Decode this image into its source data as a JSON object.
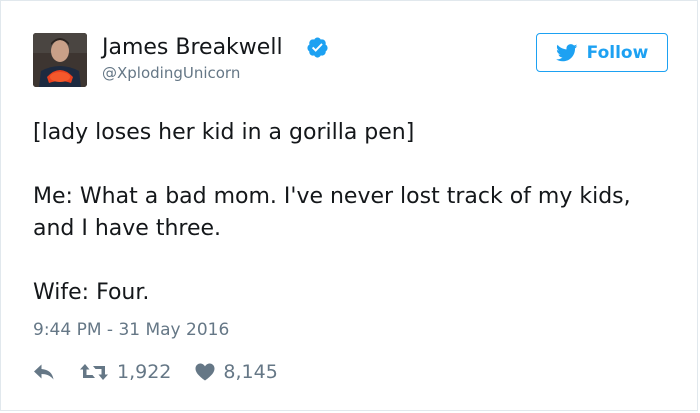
{
  "author": {
    "name": "James Breakwell",
    "handle": "@XplodingUnicorn",
    "verified": true
  },
  "follow_label": "Follow",
  "tweet": {
    "lines": [
      "[lady loses her kid in a gorilla pen]",
      "Me: What a bad mom. I've never lost track of my kids, and I have three.",
      "Wife: Four."
    ],
    "timestamp": "9:44 PM - 31 May 2016"
  },
  "stats": {
    "retweets": "1,922",
    "likes": "8,145"
  },
  "icons": {
    "verified": "verified-badge-icon",
    "follow": "twitter-bird-icon",
    "reply": "reply-arrow-icon",
    "retweet": "retweet-icon",
    "like": "heart-icon"
  },
  "colors": {
    "accent": "#1da1f2",
    "muted": "#657786",
    "text": "#14171a",
    "border": "#e1e8ed"
  }
}
